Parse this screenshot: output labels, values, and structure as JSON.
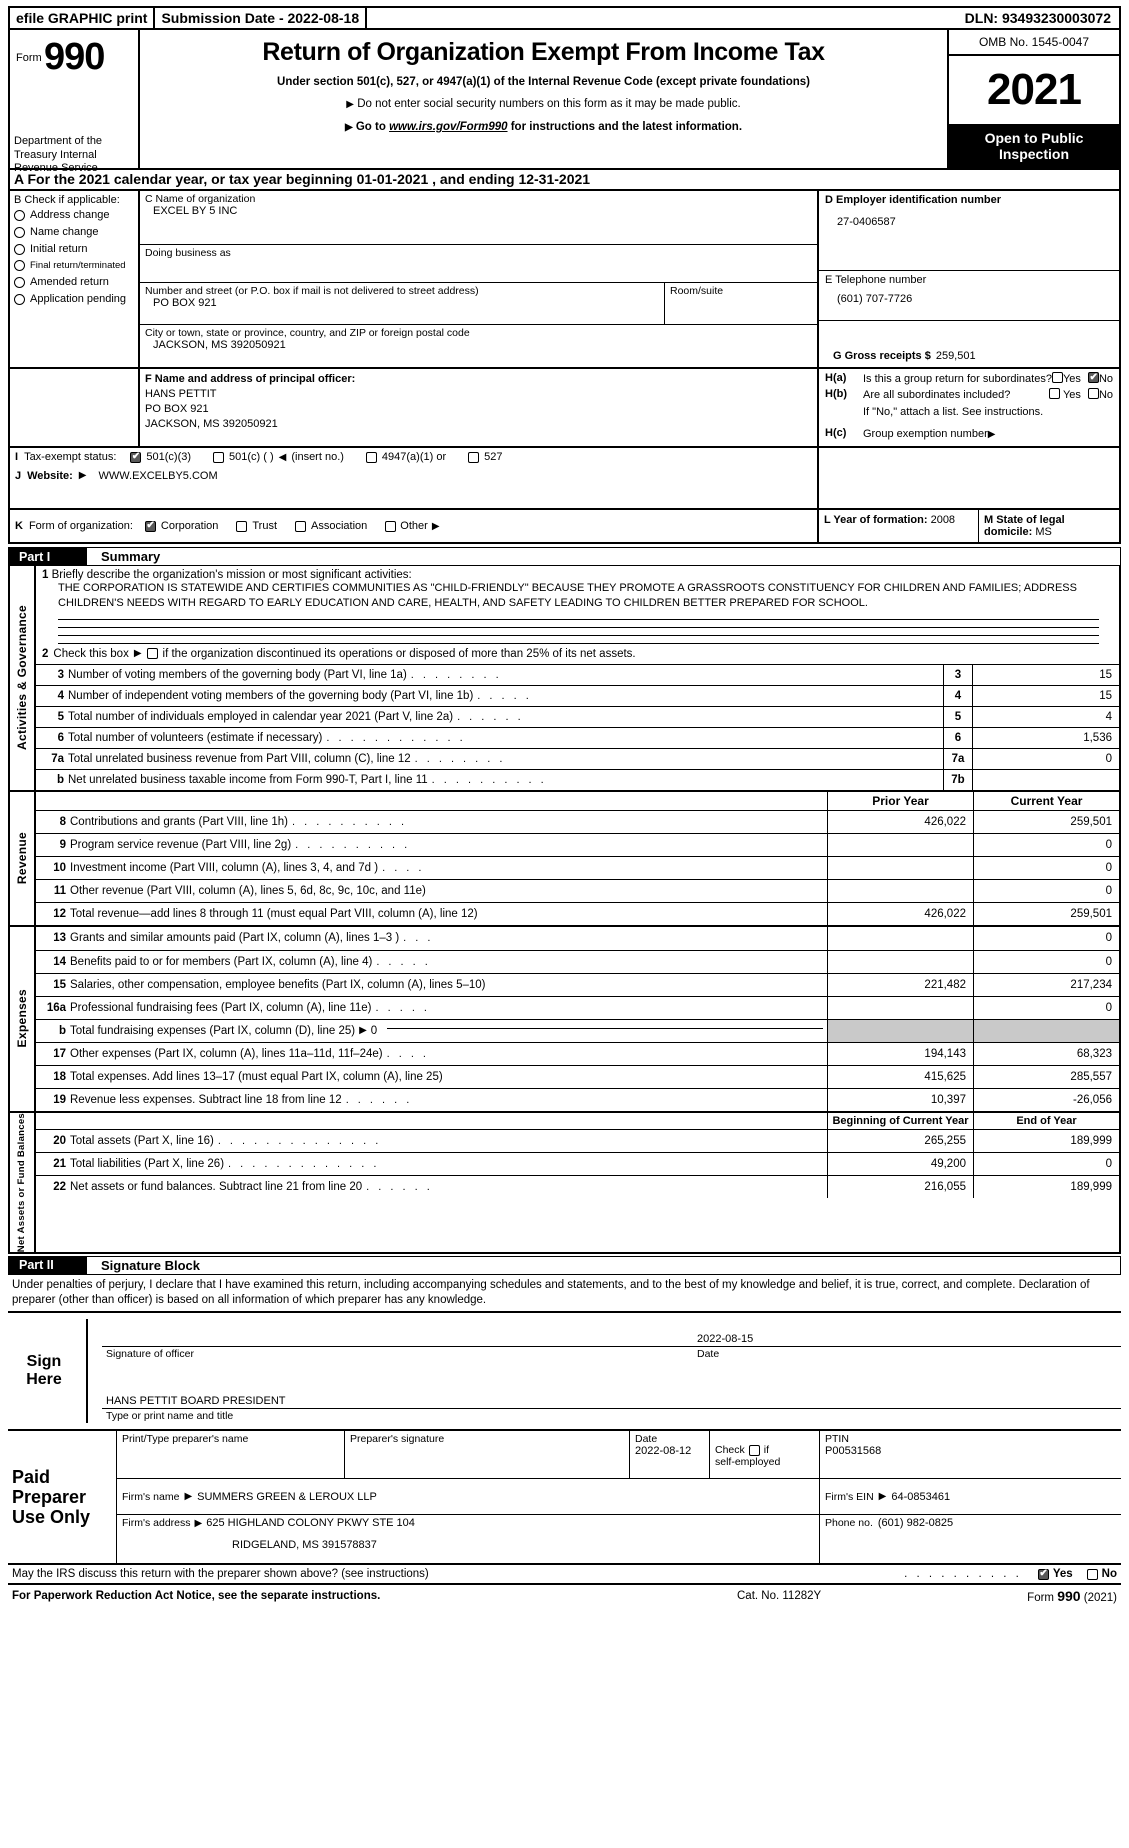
{
  "efile": {
    "graphic_print": "efile GRAPHIC print",
    "submission_date": "Submission Date - 2022-08-18",
    "dln": "DLN: 93493230003072"
  },
  "header": {
    "form_word": "Form",
    "form_number": "990",
    "department": "Department of the Treasury Internal Revenue Service",
    "title": "Return of Organization Exempt From Income Tax",
    "subtitle": "Under section 501(c), 527, or 4947(a)(1) of the Internal Revenue Code (except private foundations)",
    "note1": "Do not enter social security numbers on this form as it may be made public.",
    "note2_prefix": "Go to ",
    "note2_link": "www.irs.gov/Form990",
    "note2_suffix": " for instructions and the latest information.",
    "omb": "OMB No. 1545-0047",
    "tax_year": "2021",
    "open_line1": "Open to Public",
    "open_line2": "Inspection"
  },
  "line_a": "A For the 2021 calendar year, or tax year beginning 01-01-2021   , and ending 12-31-2021",
  "section_b": {
    "label": "B  Check if applicable:",
    "items": [
      {
        "label": "Address change",
        "checked": false
      },
      {
        "label": "Name change",
        "checked": false
      },
      {
        "label": "Initial return",
        "checked": false
      },
      {
        "label": "Final return/terminated",
        "checked": false
      },
      {
        "label": "Amended return",
        "checked": false
      },
      {
        "label": "Application pending",
        "checked": false
      }
    ]
  },
  "section_c": {
    "name_label": "C Name of organization",
    "name_value": "EXCEL BY 5 INC",
    "dba_label": "Doing business as",
    "dba_value": "",
    "street_label": "Number and street (or P.O. box if mail is not delivered to street address)",
    "street_value": "PO BOX 921",
    "room_label": "Room/suite",
    "room_value": "",
    "city_label": "City or town, state or province, country, and ZIP or foreign postal code",
    "city_value": "JACKSON, MS  392050921"
  },
  "section_d": {
    "ein_label": "D Employer identification number",
    "ein_value": "27-0406587",
    "phone_label": "E Telephone number",
    "phone_value": "(601) 707-7726",
    "gross_label": "G Gross receipts $",
    "gross_value": "259,501"
  },
  "section_f": {
    "label": "F  Name and address of principal officer:",
    "line1": "HANS PETTIT",
    "line2": "PO BOX 921",
    "line3": "JACKSON, MS  392050921"
  },
  "section_h": {
    "ha_key": "H(a)",
    "ha_text": "Is this a group return for subordinates?",
    "ha_yes": "Yes",
    "ha_no": "No",
    "ha_yes_checked": false,
    "ha_no_checked": true,
    "hb_key": "H(b)",
    "hb_text": "Are all subordinates included?",
    "hb_yes": "Yes",
    "hb_no": "No",
    "hb_yes_checked": false,
    "hb_no_checked": false,
    "hb_note": "If \"No,\" attach a list. See instructions.",
    "hc_key": "H(c)",
    "hc_text": "Group exemption number",
    "hc_value": ""
  },
  "section_i": {
    "label": "Tax-exempt status:",
    "letter": "I",
    "options": [
      {
        "label": "501(c)(3)",
        "checked": true
      },
      {
        "label": "501(c) (  )",
        "checked": false,
        "suffix": "(insert no.)"
      },
      {
        "label": "4947(a)(1) or",
        "checked": false
      },
      {
        "label": "527",
        "checked": false
      }
    ]
  },
  "section_j": {
    "letter": "J",
    "label": "Website:",
    "value": "WWW.EXCELBY5.COM"
  },
  "section_k": {
    "letter": "K",
    "label": "Form of organization:",
    "options": [
      {
        "label": "Corporation",
        "checked": true
      },
      {
        "label": "Trust",
        "checked": false
      },
      {
        "label": "Association",
        "checked": false
      },
      {
        "label": "Other",
        "checked": false
      }
    ]
  },
  "section_l": {
    "label": "L Year of formation:",
    "value": "2008"
  },
  "section_m": {
    "label": "M State of legal domicile:",
    "value": "MS"
  },
  "part1": {
    "part_label": "Part I",
    "title": "Summary",
    "sidebar": "Activities & Governance",
    "line1_num": "1",
    "line1_label": "Briefly describe the organization's mission or most significant activities:",
    "mission": "THE CORPORATION IS STATEWIDE AND CERTIFIES COMMUNITIES AS \"CHILD-FRIENDLY\" BECAUSE THEY PROMOTE A GRASSROOTS CONSTITUENCY FOR CHILDREN AND FAMILIES; ADDRESS CHILDREN'S NEEDS WITH REGARD TO EARLY EDUCATION AND CARE, HEALTH, AND SAFETY LEADING TO CHILDREN BETTER PREPARED FOR SCHOOL.",
    "line2_num": "2",
    "line2_text_a": "Check this box",
    "line2_text_b": "if the organization discontinued its operations or disposed of more than 25% of its net assets.",
    "line2_checked": false,
    "rows": [
      {
        "num": "3",
        "text": "Number of voting members of the governing body (Part VI, line 1a)",
        "key": "3",
        "value": "15"
      },
      {
        "num": "4",
        "text": "Number of independent voting members of the governing body (Part VI, line 1b)",
        "key": "4",
        "value": "15"
      },
      {
        "num": "5",
        "text": "Total number of individuals employed in calendar year 2021 (Part V, line 2a)",
        "key": "5",
        "value": "4"
      },
      {
        "num": "6",
        "text": "Total number of volunteers (estimate if necessary)",
        "key": "6",
        "value": "1,536"
      },
      {
        "num": "7a",
        "text": "Total unrelated business revenue from Part VIII, column (C), line 12",
        "key": "7a",
        "value": "0"
      },
      {
        "num": "b",
        "text": "Net unrelated business taxable income from Form 990-T, Part I, line 11",
        "key": "7b",
        "value": ""
      }
    ]
  },
  "money_table": {
    "revenue_sidebar": "Revenue",
    "expenses_sidebar": "Expenses",
    "netassets_sidebar": "Net Assets or Fund Balances",
    "col_prior": "Prior Year",
    "col_current": "Current Year",
    "col_begin": "Beginning of Current Year",
    "col_end": "End of Year",
    "revenue_rows": [
      {
        "num": "8",
        "text": "Contributions and grants (Part VIII, line 1h)",
        "dots": ".  .  .  .  .  .  .  .  .  .",
        "prior": "426,022",
        "current": "259,501"
      },
      {
        "num": "9",
        "text": "Program service revenue (Part VIII, line 2g)",
        "dots": ".  .  .  .  .  .  .  .  .  .",
        "prior": "",
        "current": "0"
      },
      {
        "num": "10",
        "text": "Investment income (Part VIII, column (A), lines 3, 4, and 7d )",
        "dots": ".  .  .  .",
        "prior": "",
        "current": "0"
      },
      {
        "num": "11",
        "text": "Other revenue (Part VIII, column (A), lines 5, 6d, 8c, 9c, 10c, and 11e)",
        "dots": "",
        "prior": "",
        "current": "0"
      },
      {
        "num": "12",
        "text": "Total revenue—add lines 8 through 11 (must equal Part VIII, column (A), line 12)",
        "dots": "",
        "prior": "426,022",
        "current": "259,501"
      }
    ],
    "expense_rows": [
      {
        "num": "13",
        "text": "Grants and similar amounts paid (Part IX, column (A), lines 1–3 )",
        "dots": ".  .  .",
        "prior": "",
        "current": "0"
      },
      {
        "num": "14",
        "text": "Benefits paid to or for members (Part IX, column (A), line 4)",
        "dots": ".  .  .  .  .",
        "prior": "",
        "current": "0"
      },
      {
        "num": "15",
        "text": "Salaries, other compensation, employee benefits (Part IX, column (A), lines 5–10)",
        "dots": "",
        "prior": "221,482",
        "current": "217,234"
      },
      {
        "num": "16a",
        "text": "Professional fundraising fees (Part IX, column (A), line 11e)",
        "dots": ".  .  .  .  .",
        "prior": "",
        "current": "0"
      },
      {
        "num": "b",
        "text": "Total fundraising expenses (Part IX, column (D), line 25)",
        "dots": "",
        "prior": "",
        "current": "",
        "shaded": true,
        "arrow_value": "0"
      },
      {
        "num": "17",
        "text": "Other expenses (Part IX, column (A), lines 11a–11d, 11f–24e)",
        "dots": ".  .  .  .",
        "prior": "194,143",
        "current": "68,323"
      },
      {
        "num": "18",
        "text": "Total expenses. Add lines 13–17 (must equal Part IX, column (A), line 25)",
        "dots": "",
        "prior": "415,625",
        "current": "285,557"
      },
      {
        "num": "19",
        "text": "Revenue less expenses. Subtract line 18 from line 12",
        "dots": ".  .  .  .  .  .",
        "prior": "10,397",
        "current": "-26,056"
      }
    ],
    "asset_rows": [
      {
        "num": "20",
        "text": "Total assets (Part X, line 16)",
        "dots": ".  .  .  .  .  .  .  .  .  .  .  .  .  .",
        "begin": "265,255",
        "end": "189,999"
      },
      {
        "num": "21",
        "text": "Total liabilities (Part X, line 26)",
        "dots": ".  .  .  .  .  .  .  .  .  .  .  .  .",
        "begin": "49,200",
        "end": "0"
      },
      {
        "num": "22",
        "text": "Net assets or fund balances. Subtract line 21 from line 20",
        "dots": ".  .  .  .  .  .",
        "begin": "216,055",
        "end": "189,999"
      }
    ]
  },
  "part2": {
    "part_label": "Part II",
    "title": "Signature Block",
    "perjury": "Under penalties of perjury, I declare that I have examined this return, including accompanying schedules and statements, and to the best of my knowledge and belief, it is true, correct, and complete. Declaration of preparer (other than officer) is based on all information of which preparer has any knowledge.",
    "sign_here_1": "Sign",
    "sign_here_2": "Here",
    "officer_signature_value": "",
    "officer_date_value": "2022-08-15",
    "officer_signature_caption": "Signature of officer",
    "officer_date_caption": "Date",
    "officer_name_value": "HANS PETTIT  BOARD PRESIDENT",
    "officer_name_caption": "Type or print name and title"
  },
  "preparer": {
    "label_1": "Paid",
    "label_2": "Preparer",
    "label_3": "Use Only",
    "name_header": "Print/Type preparer's name",
    "name_value": "",
    "signature_header": "Preparer's signature",
    "signature_value": "",
    "date_header": "Date",
    "date_value": "2022-08-12",
    "check_text_1": "Check",
    "check_text_2": "if",
    "check_text_3": "self-employed",
    "check_checked": false,
    "ptin_header": "PTIN",
    "ptin_value": "P00531568",
    "firm_name_label": "Firm's name",
    "firm_name_value": "SUMMERS GREEN & LEROUX LLP",
    "firm_ein_label": "Firm's EIN",
    "firm_ein_value": "64-0853461",
    "firm_address_label": "Firm's address",
    "firm_address_value": "625 HIGHLAND COLONY PKWY STE 104",
    "firm_address_value2": "RIDGELAND, MS  391578837",
    "phone_label": "Phone no.",
    "phone_value": "(601) 982-0825"
  },
  "irs_question": {
    "text": "May the IRS discuss this return with the preparer shown above? (see instructions)",
    "dots": ".  .  .  .  .  .  .  .  .  .",
    "yes": "Yes",
    "no": "No",
    "yes_checked": true,
    "no_checked": false
  },
  "footer": {
    "notice": "For Paperwork Reduction Act Notice, see the separate instructions.",
    "cat": "Cat. No. 11282Y",
    "form_prefix": "Form ",
    "form_number": "990",
    "form_year": " (2021)"
  }
}
